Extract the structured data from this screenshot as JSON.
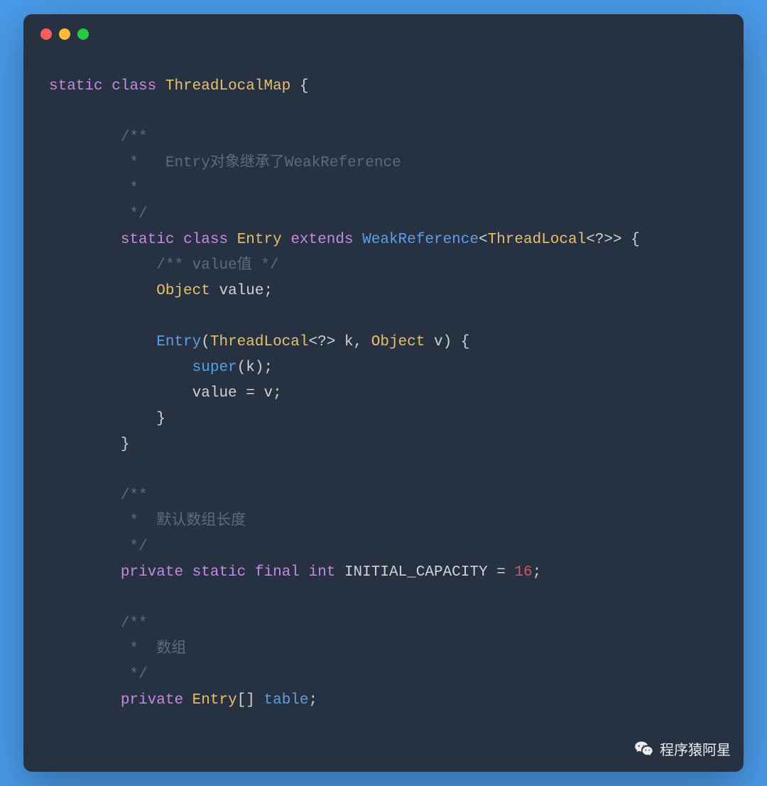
{
  "tokens": {
    "kw_static": "static",
    "kw_class": "class",
    "kw_extends": "extends",
    "kw_private": "private",
    "kw_final": "final",
    "kw_int": "int",
    "kw_super": "super",
    "cls_ThreadLocalMap": "ThreadLocalMap",
    "cls_Entry": "Entry",
    "cls_WeakReference": "WeakReference",
    "cls_ThreadLocal": "ThreadLocal",
    "cls_Object": "Object",
    "id_value": "value",
    "id_k": "k",
    "id_v": "v",
    "id_INITIAL_CAPACITY": "INITIAL_CAPACITY",
    "id_table": "table",
    "num_16": "16",
    "brackets_array": "[]",
    "wildcard": "<?>",
    "wildcard_close": "<?>>",
    "lbrace": "{",
    "rbrace": "}",
    "lparen": "(",
    "rparen": ")",
    "semi": ";",
    "comma": ",",
    "eq": "=",
    "lt": "<",
    "gt": ">"
  },
  "comments": {
    "c1_open": "/**",
    "c1_line1": " *   Entry对象继承了WeakReference",
    "c1_line2": " *",
    "c1_close": " */",
    "c2_inline": "/** value值 */",
    "c3_open": "/**",
    "c3_line1": " *  默认数组长度",
    "c3_close": " */",
    "c4_open": "/**",
    "c4_line1": " *  数组",
    "c4_close": " */"
  },
  "watermark": {
    "text": "程序猿阿星"
  }
}
